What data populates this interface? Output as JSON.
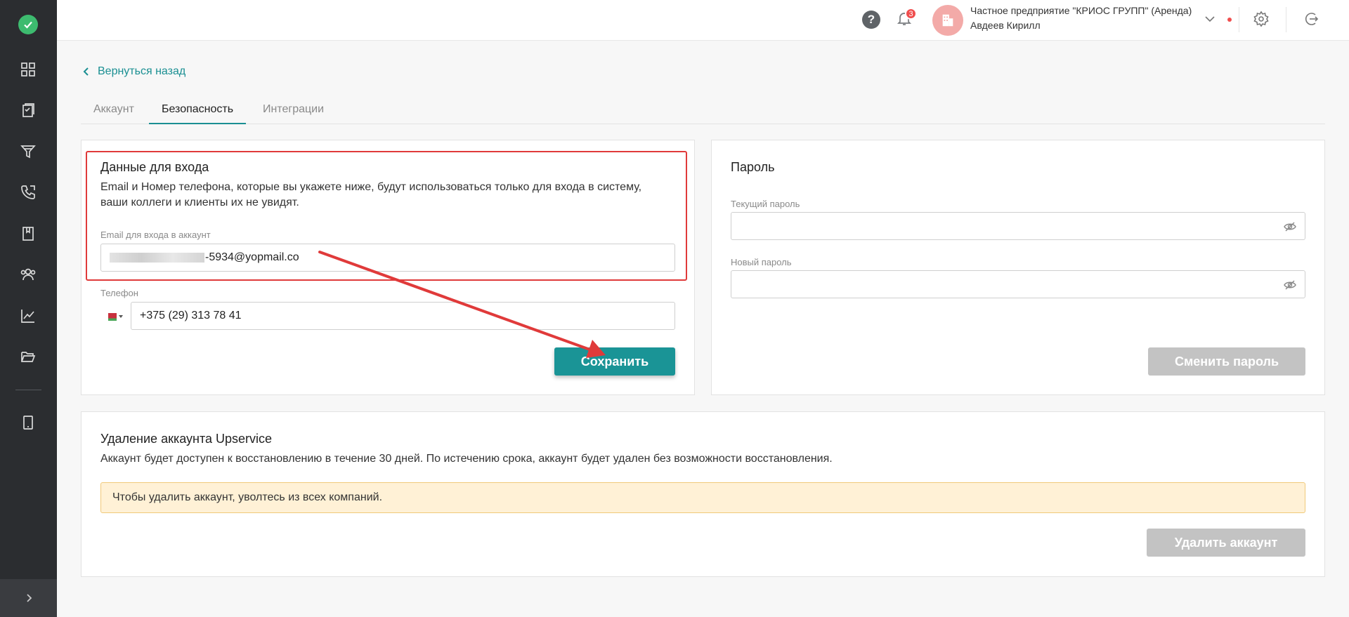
{
  "header": {
    "help_label": "?",
    "notifications_count": "3",
    "company_name": "Частное предприятие \"КРИОС ГРУПП\" (Аренда)",
    "user_name": "Авдеев Кирилл"
  },
  "sidebar": {
    "items": [
      "dashboard-icon",
      "documents-icon",
      "funnel-icon",
      "phone-icon",
      "book-icon",
      "users-icon",
      "chart-icon",
      "folder-icon",
      "tablet-icon"
    ]
  },
  "nav": {
    "back_label": "Вернуться назад"
  },
  "tabs": [
    {
      "label": "Аккаунт"
    },
    {
      "label": "Безопасность"
    },
    {
      "label": "Интеграции"
    }
  ],
  "login_data": {
    "title": "Данные для входа",
    "description_line1": "Email и Номер телефона, которые вы укажете ниже, будут использоваться только для входа в систему,",
    "description_line2": "ваши коллеги и клиенты их не увидят.",
    "email_label": "Email для входа в аккаунт",
    "email_value_visible": "-5934@yopmail.co",
    "phone_label": "Телефон",
    "phone_value": "+375 (29) 313 78 41",
    "save_label": "Сохранить"
  },
  "password": {
    "title": "Пароль",
    "current_label": "Текущий пароль",
    "new_label": "Новый пароль",
    "change_label": "Сменить пароль"
  },
  "delete_account": {
    "title": "Удаление аккаунта Upservice",
    "description": "Аккаунт будет доступен к восстановлению в течение 30 дней. По истечению срока, аккаунт будет удален без возможности восстановления.",
    "warning": "Чтобы удалить аккаунт, уволтесь из всех компаний.",
    "delete_label": "Удалить аккаунт"
  },
  "colors": {
    "accent": "#1a9496",
    "sidebar": "#2b2d30",
    "annotation": "#e03a3a",
    "warning_bg": "#fff1d6"
  }
}
